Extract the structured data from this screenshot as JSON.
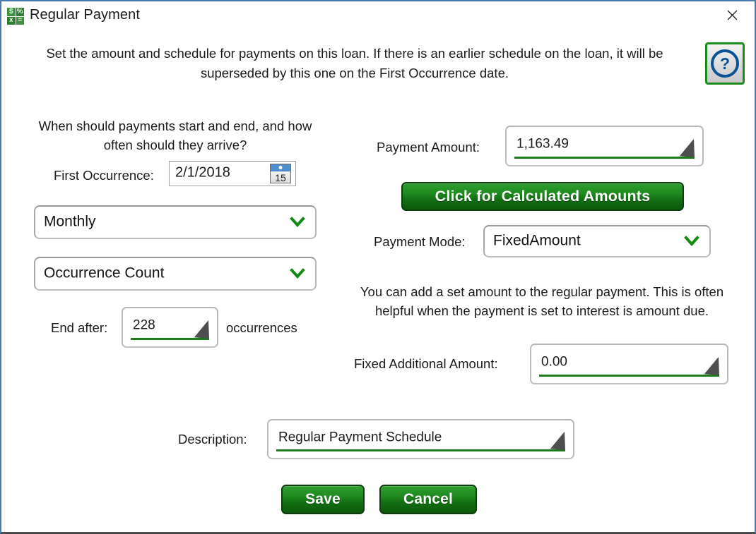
{
  "window": {
    "title": "Regular Payment",
    "app_icon_symbols": [
      "$",
      "%",
      "x",
      "="
    ],
    "close_icon": "close-icon",
    "help_icon": "?",
    "accent_green": "#1a7d1a",
    "border_blue": "#4a7ab0"
  },
  "instructions": "Set the amount and schedule for payments on this loan.  If there is an earlier schedule on the loan, it will be superseded by this one on the First Occurrence date.",
  "left": {
    "prompt": "When should payments start and end, and how often should they arrive?",
    "first_occurrence_label": "First Occurrence:",
    "first_occurrence_value": "2/1/2018",
    "calendar_icon_day": "15",
    "frequency_value": "Monthly",
    "end_type_value": "Occurrence Count",
    "end_after_label": "End after:",
    "end_after_value": "228",
    "occurrences_label": "occurrences"
  },
  "right": {
    "payment_amount_label": "Payment Amount:",
    "payment_amount_value": "1,163.49",
    "calculate_button": "Click for Calculated Amounts",
    "payment_mode_label": "Payment Mode:",
    "payment_mode_value": "FixedAmount",
    "additional_note": "You can add a set amount to the regular payment. This is often helpful when the payment is set to interest is amount due.",
    "fixed_additional_label": "Fixed Additional Amount:",
    "fixed_additional_value": "0.00"
  },
  "footer": {
    "description_label": "Description:",
    "description_value": "Regular Payment Schedule",
    "save_label": "Save",
    "cancel_label": "Cancel"
  }
}
